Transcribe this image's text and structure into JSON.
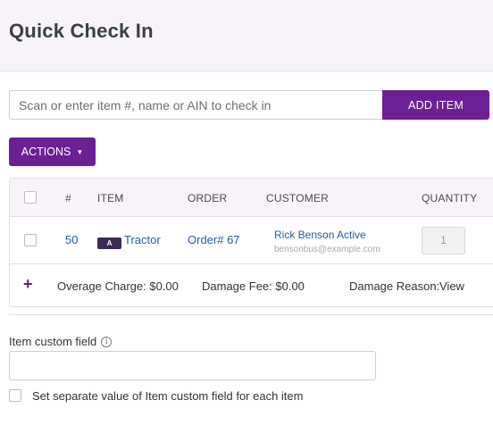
{
  "header": {
    "title": "Quick Check In"
  },
  "scan": {
    "placeholder": "Scan or enter item #, name or AIN to check in",
    "value": "",
    "add_label": "ADD ITEM"
  },
  "actions": {
    "label": "ACTIONS",
    "caret": "▼"
  },
  "table": {
    "columns": {
      "num": "#",
      "item": "ITEM",
      "order": "ORDER",
      "customer": "CUSTOMER",
      "quantity": "QUANTITY"
    },
    "rows": [
      {
        "num": "50",
        "badge": "A",
        "item": "Tractor",
        "order": "Order# 67",
        "customer": "Rick Benson Active",
        "email": "bensonbus@example.com",
        "quantity": "1"
      }
    ],
    "summary": {
      "plus": "+",
      "overage": "Overage Charge: $0.00",
      "damage_fee": "Damage Fee: $0.00",
      "damage_reason_label": "Damage Reason:",
      "damage_reason_link": "View"
    }
  },
  "custom_field": {
    "label": "Item custom field",
    "info": "i",
    "value": "",
    "separate_label": "Set separate value of Item custom field for each item"
  },
  "colors": {
    "primary": "#6b2096",
    "link": "#245f9a",
    "header_bg": "#f7f3f9"
  }
}
